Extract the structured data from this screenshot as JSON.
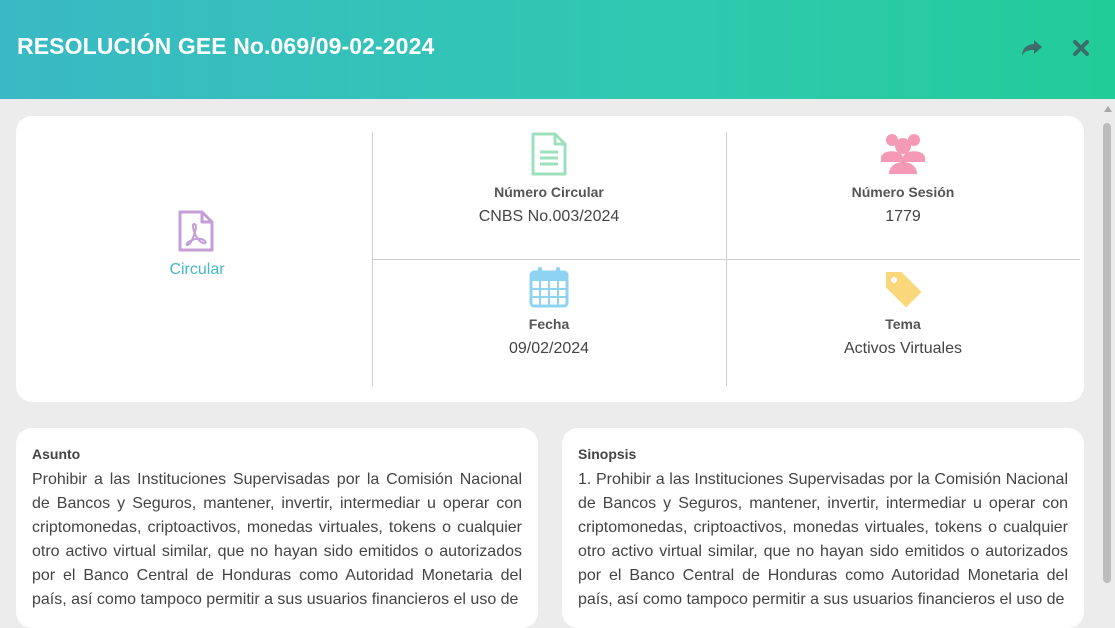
{
  "header": {
    "title": "RESOLUCIÓN GEE No.069/09-02-2024",
    "share_icon": "share-icon",
    "close_icon": "close-icon"
  },
  "info": {
    "document_type": {
      "icon": "pdf-file-icon",
      "label": "Circular"
    },
    "cells": [
      {
        "icon": "document-icon",
        "label": "Número Circular",
        "value": "CNBS No.003/2024",
        "color": "#9ee0bd"
      },
      {
        "icon": "users-icon",
        "label": "Número Sesión",
        "value": "1779",
        "color": "#f59ab6"
      },
      {
        "icon": "calendar-icon",
        "label": "Fecha",
        "value": "09/02/2024",
        "color": "#8fd3f2"
      },
      {
        "icon": "tag-icon",
        "label": "Tema",
        "value": "Activos Virtuales",
        "color": "#f9d77a"
      }
    ]
  },
  "asunto": {
    "label": "Asunto",
    "text": "Prohibir a las Instituciones Supervisadas por la Comisión Nacional de Bancos y Seguros, mantener, invertir, intermediar u operar con criptomonedas, criptoactivos, monedas virtuales, tokens o cualquier otro activo virtual similar, que no hayan sido emitidos o autorizados por el Banco Central de Honduras como Autoridad Monetaria del país, así como tampoco permitir a sus usuarios financieros el uso de"
  },
  "sinopsis": {
    "label": "Sinopsis",
    "text": "1. Prohibir a las Instituciones Supervisadas por la Comisión Nacional de Bancos y Seguros, mantener, invertir, intermediar u operar con criptomonedas, criptoactivos, monedas virtuales, tokens o cualquier otro activo virtual similar, que no hayan sido emitidos o autorizados por el Banco Central de Honduras como Autoridad Monetaria del país, así como tampoco permitir a sus usuarios financieros el uso de"
  }
}
